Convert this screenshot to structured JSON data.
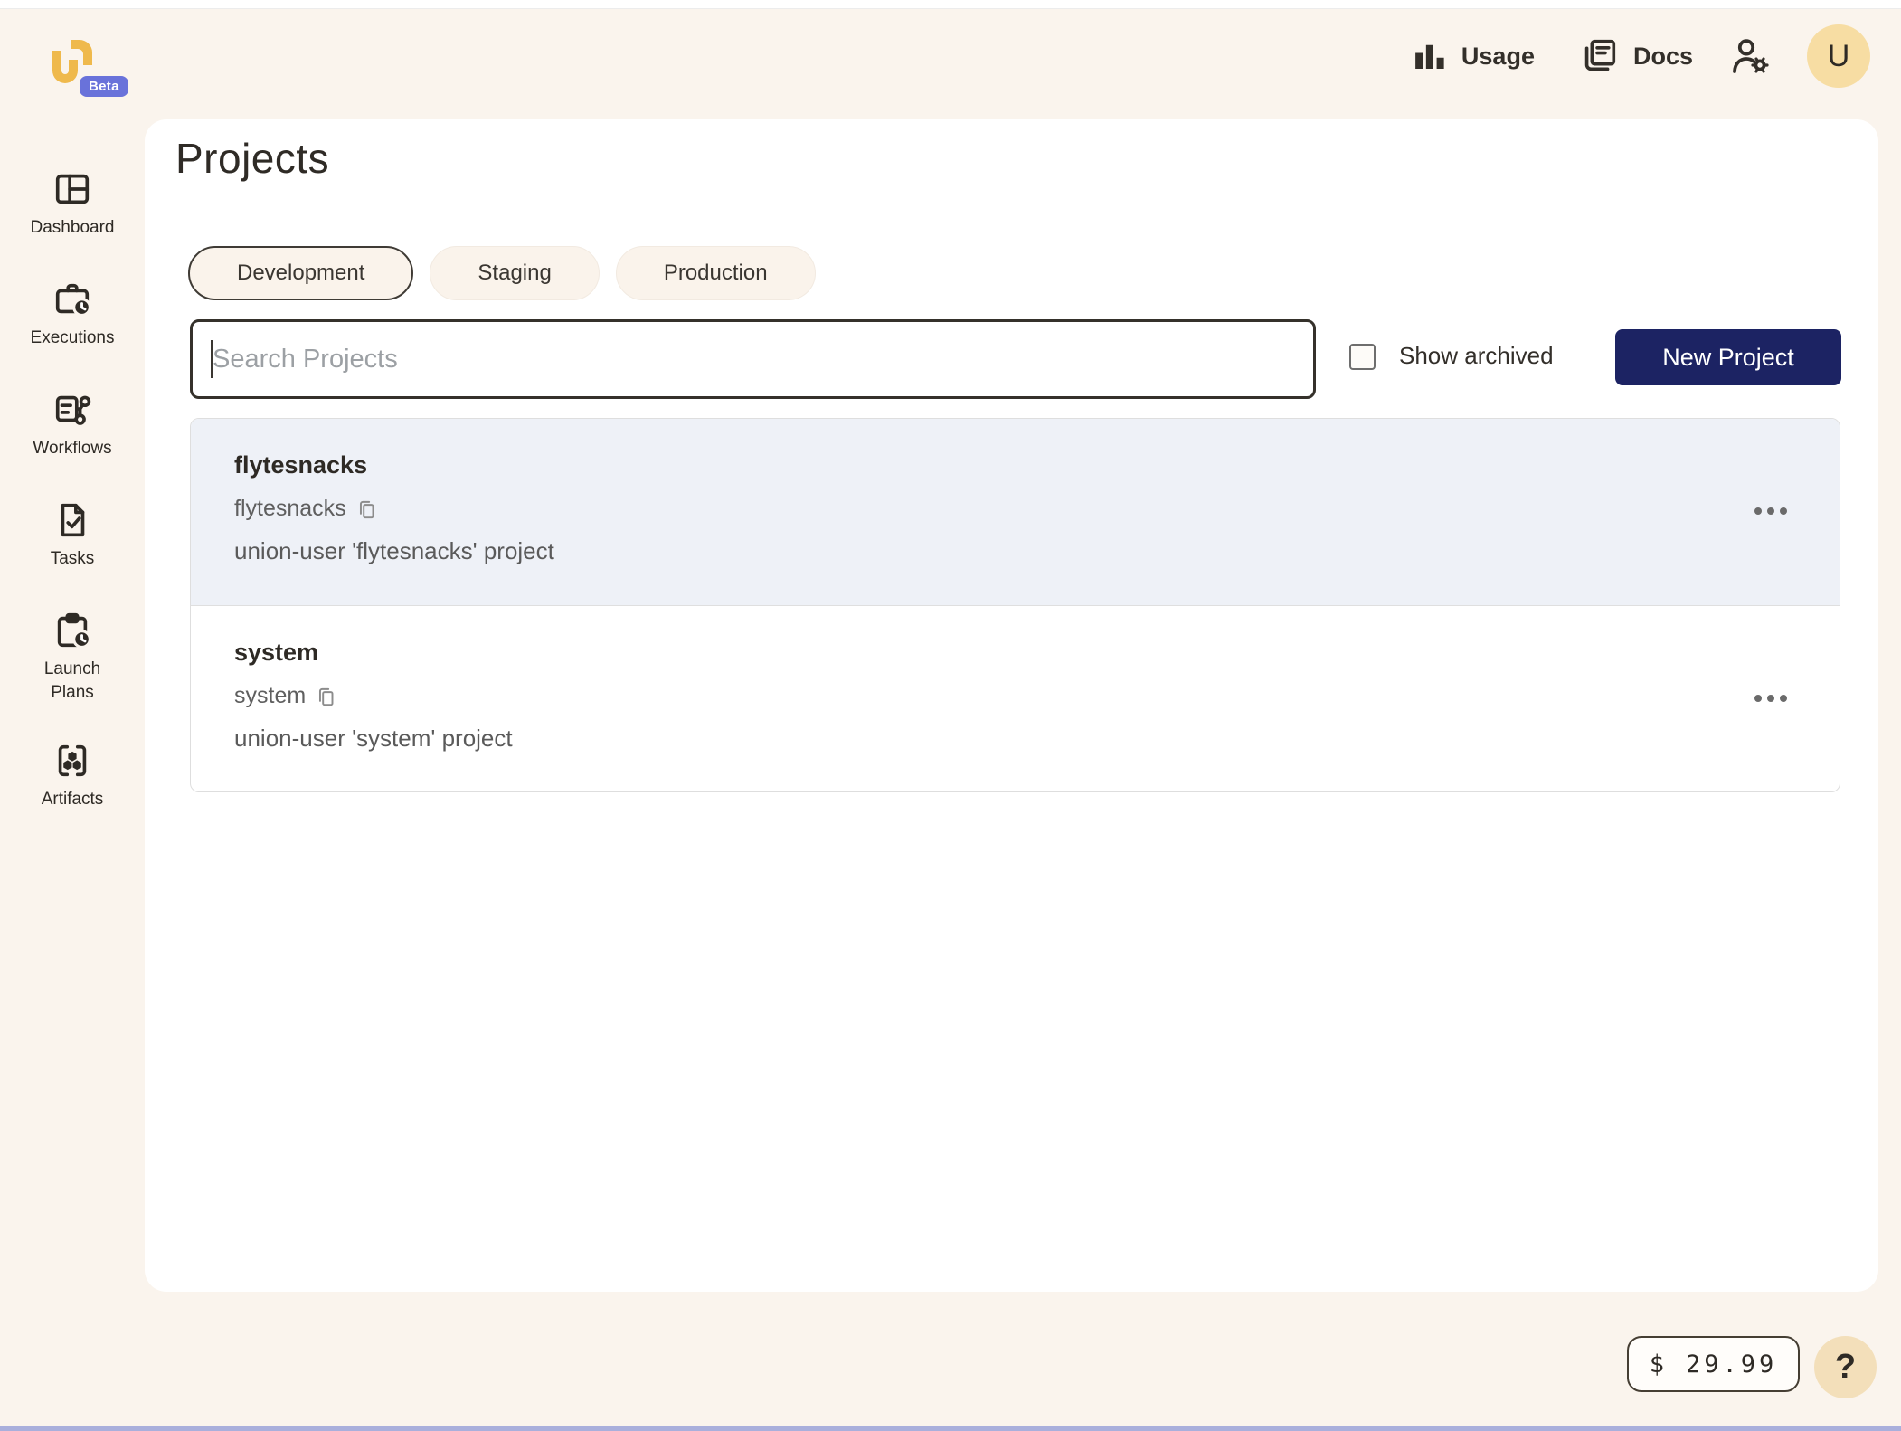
{
  "app": {
    "logo_name": "union-logo",
    "beta_label": "Beta",
    "avatar_initial": "U"
  },
  "topbar": {
    "usage_label": "Usage",
    "docs_label": "Docs"
  },
  "sidebar": {
    "items": [
      {
        "label": "Dashboard",
        "icon": "dashboard-icon"
      },
      {
        "label": "Executions",
        "icon": "executions-icon"
      },
      {
        "label": "Workflows",
        "icon": "workflows-icon"
      },
      {
        "label": "Tasks",
        "icon": "tasks-icon"
      },
      {
        "label": "Launch Plans",
        "icon": "launch-plans-icon"
      },
      {
        "label": "Artifacts",
        "icon": "artifacts-icon"
      }
    ]
  },
  "main": {
    "title": "Projects",
    "tabs": [
      {
        "label": "Development",
        "selected": true
      },
      {
        "label": "Staging",
        "selected": false
      },
      {
        "label": "Production",
        "selected": false
      }
    ],
    "search": {
      "placeholder": "Search Projects",
      "value": ""
    },
    "show_archived_label": "Show archived",
    "show_archived_checked": false,
    "new_project_label": "New Project",
    "projects": [
      {
        "name": "flytesnacks",
        "id": "flytesnacks",
        "description": "union-user 'flytesnacks' project"
      },
      {
        "name": "system",
        "id": "system",
        "description": "union-user 'system' project"
      }
    ]
  },
  "footer": {
    "currency_symbol": "$",
    "amount": "29.99",
    "help_label": "?"
  },
  "colors": {
    "background": "#FAF4ED",
    "panel": "#FFFFFF",
    "accent_navy": "#1C2363",
    "brand_gold": "#EFB94C",
    "beta_indigo": "#6972DA",
    "avatar_gold": "#F7DDA3",
    "row_hover": "#EEF1F7",
    "bottom_bar": "#A9AFDC",
    "help_tan": "#F3DFBA"
  }
}
